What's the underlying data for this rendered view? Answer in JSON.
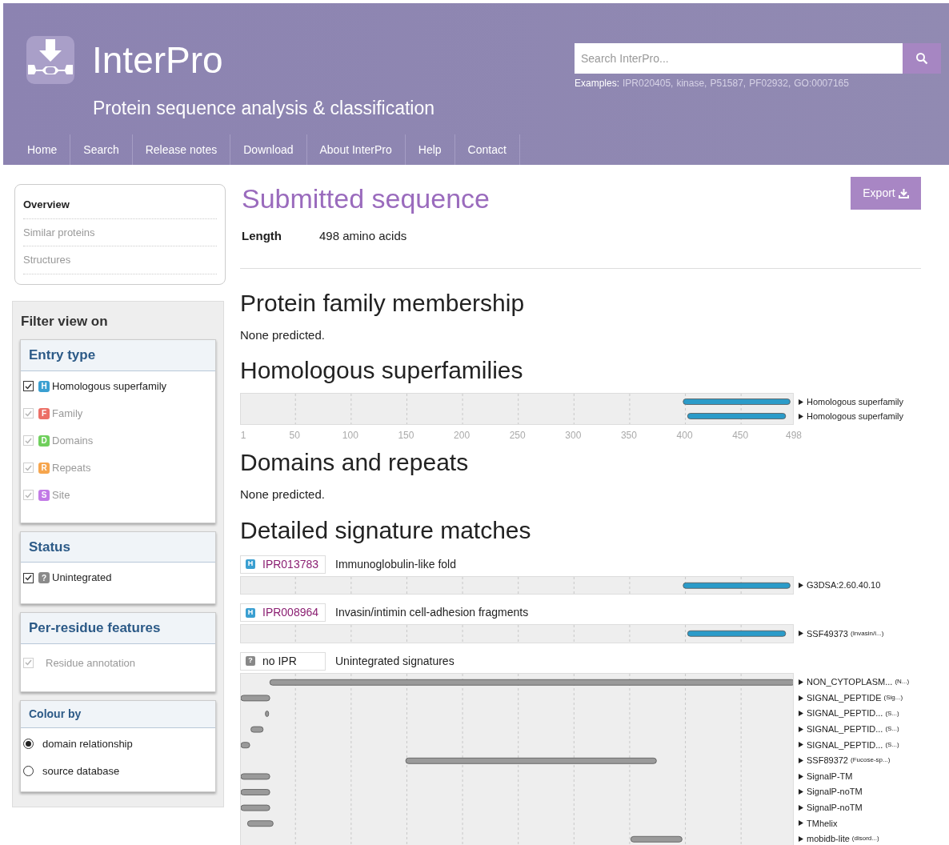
{
  "header": {
    "logo_title": "InterPro",
    "subtitle": "Protein sequence analysis & classification",
    "search": {
      "placeholder": "Search InterPro...",
      "examples_label": "Examples:",
      "examples": [
        "IPR020405,",
        "kinase,",
        "P51587,",
        "PF02932,",
        "GO:0007165"
      ]
    },
    "nav": [
      {
        "label": "Home"
      },
      {
        "label": "Search"
      },
      {
        "label": "Release notes"
      },
      {
        "label": "Download"
      },
      {
        "label": "About InterPro"
      },
      {
        "label": "Help"
      },
      {
        "label": "Contact"
      }
    ]
  },
  "sidebar": {
    "menu": [
      {
        "label": "Overview",
        "selected": true
      },
      {
        "label": "Similar proteins",
        "selected": false
      },
      {
        "label": "Structures",
        "selected": false
      }
    ],
    "filter_title": "Filter view on",
    "entry_type": {
      "title": "Entry type",
      "items": [
        {
          "badge": "H",
          "label": "Homologous superfamily",
          "checked": true,
          "disabled": false,
          "color": "#3a9fd1"
        },
        {
          "badge": "F",
          "label": "Family",
          "checked": true,
          "disabled": true,
          "color": "#ec6f66"
        },
        {
          "badge": "D",
          "label": "Domains",
          "checked": true,
          "disabled": true,
          "color": "#6fcf5c"
        },
        {
          "badge": "R",
          "label": "Repeats",
          "checked": true,
          "disabled": true,
          "color": "#f6a54d"
        },
        {
          "badge": "S",
          "label": "Site",
          "checked": true,
          "disabled": true,
          "color": "#c27ae6"
        }
      ]
    },
    "status": {
      "title": "Status",
      "items": [
        {
          "badge": "?",
          "label": "Unintegrated",
          "checked": true,
          "disabled": false,
          "color": "#8a8a8a"
        }
      ]
    },
    "per_residue": {
      "title": "Per-residue features",
      "items": [
        {
          "label": "Residue annotation",
          "checked": true,
          "disabled": true
        }
      ]
    },
    "colour_by": {
      "title": "Colour by",
      "options": [
        {
          "label": "domain relationship",
          "selected": true
        },
        {
          "label": "source database",
          "selected": false
        }
      ]
    }
  },
  "main": {
    "title": "Submitted sequence",
    "export_button": "Export",
    "length_label": "Length",
    "length_value": "498 amino acids",
    "family": {
      "title": "Protein family membership",
      "text": "None predicted."
    },
    "superfamilies": {
      "title": "Homologous superfamilies",
      "kind": "homologous_superfamily",
      "labels": [
        {
          "name": "Homologous superfamily"
        },
        {
          "name": "Homologous superfamily"
        }
      ],
      "axis_labels": [
        "1",
        "50",
        "100",
        "150",
        "200",
        "250",
        "300",
        "350",
        "400",
        "450",
        "498"
      ]
    },
    "domains": {
      "title": "Domains and repeats",
      "text": "None predicted."
    },
    "detailed": {
      "title": "Detailed signature matches",
      "entries": [
        {
          "kind": "homologous_superfamily",
          "badge": "H",
          "accession": "IPR013783",
          "name": "Immunoglobulin-like fold",
          "labels": [
            {
              "name": "G3DSA:2.60.40.10"
            }
          ]
        },
        {
          "kind": "homologous_superfamily",
          "badge": "H",
          "accession": "IPR008964",
          "name": "Invasin/intimin cell-adhesion fragments",
          "labels": [
            {
              "name": "SSF49373",
              "note": "(Invasin/i...)"
            }
          ]
        },
        {
          "kind": "unintegrated",
          "badge": "?",
          "accession": "no IPR",
          "name": "Unintegrated signatures",
          "labels": [
            {
              "name": "NON_CYTOPLASM...",
              "note": "(N...)"
            },
            {
              "name": "SIGNAL_PEPTIDE",
              "note": "(Sig...)"
            },
            {
              "name": "SIGNAL_PEPTID...",
              "note": "(S...)"
            },
            {
              "name": "SIGNAL_PEPTID...",
              "note": "(S...)"
            },
            {
              "name": "SIGNAL_PEPTID...",
              "note": "(S...)"
            },
            {
              "name": "SSF89372",
              "note": "(Fucose-sp...)"
            },
            {
              "name": "SignalP-TM"
            },
            {
              "name": "SignalP-noTM"
            },
            {
              "name": "SignalP-noTM"
            },
            {
              "name": "TMhelix"
            },
            {
              "name": "mobidb-lite",
              "note": "(disord...)"
            }
          ]
        }
      ]
    }
  }
}
